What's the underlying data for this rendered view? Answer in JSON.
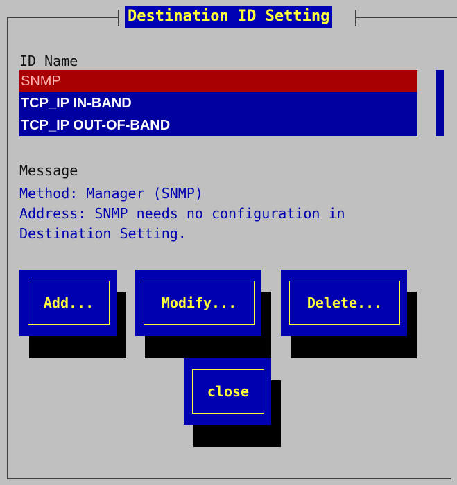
{
  "dialog": {
    "title": "Destination ID Setting"
  },
  "id_list": {
    "label": "ID Name",
    "items": [
      {
        "label": "SNMP",
        "selected": true
      },
      {
        "label": "TCP_IP IN-BAND",
        "selected": false
      },
      {
        "label": "TCP_IP OUT-OF-BAND",
        "selected": false
      }
    ]
  },
  "message": {
    "label": "Message",
    "lines": [
      "Method: Manager (SNMP)",
      "Address: SNMP needs no configuration in",
      "Destination Setting."
    ]
  },
  "buttons": {
    "add": "Add...",
    "modify": "Modify...",
    "delete": "Delete...",
    "close": "close"
  },
  "colors": {
    "background": "#c0c0c0",
    "panel_blue": "#0000b0",
    "selection_red": "#a80000",
    "button_text_yellow": "#ffff3a",
    "message_text_blue": "#0000b0"
  }
}
